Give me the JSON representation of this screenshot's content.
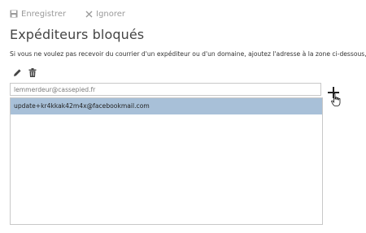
{
  "toolbar": {
    "save_label": "Enregistrer",
    "ignore_label": "Ignorer"
  },
  "page": {
    "title": "Expéditeurs bloqués",
    "description": "Si vous ne voulez pas recevoir du courrier d'un expéditeur ou d'un domaine, ajoutez l'adresse à la zone ci-dessous, cliquez sur le sign"
  },
  "entry": {
    "value": "lemmerdeur@cassepied.fr"
  },
  "blocked_list": {
    "items": [
      {
        "label": "update+kr4kkak42m4x@facebookmail.com"
      }
    ]
  },
  "icons": {
    "save": "save-icon",
    "ignore": "close-icon",
    "edit": "pencil-icon",
    "delete": "trash-icon",
    "add": "plus-icon"
  },
  "colors": {
    "selection": "#a8c0d8",
    "muted": "#9a9a9a"
  }
}
